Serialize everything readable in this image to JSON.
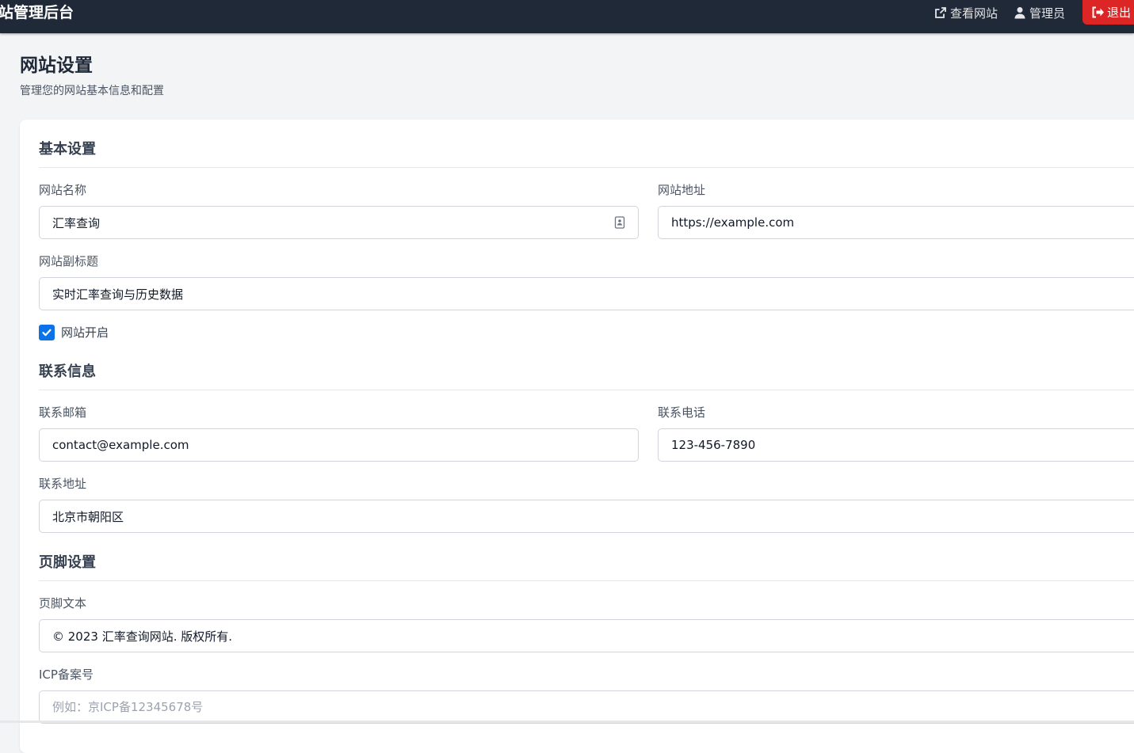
{
  "header": {
    "brand": "站管理后台",
    "view_site_label": "查看网站",
    "user_label": "管理员",
    "logout_label": "退出"
  },
  "page": {
    "title": "网站设置",
    "subtitle": "管理您的网站基本信息和配置"
  },
  "sections": {
    "basic": {
      "title": "基本设置",
      "site_name_label": "网站名称",
      "site_name_value": "汇率查询",
      "site_url_label": "网站地址",
      "site_url_value": "https://example.com",
      "subtitle_label": "网站副标题",
      "subtitle_value": "实时汇率查询与历史数据",
      "site_open_label": "网站开启",
      "site_open_checked": true
    },
    "contact": {
      "title": "联系信息",
      "email_label": "联系邮箱",
      "email_value": "contact@example.com",
      "phone_label": "联系电话",
      "phone_value": "123-456-7890",
      "address_label": "联系地址",
      "address_value": "北京市朝阳区"
    },
    "footer": {
      "title": "页脚设置",
      "footer_text_label": "页脚文本",
      "footer_text_value": "© 2023 汇率查询网站. 版权所有.",
      "icp_label": "ICP备案号",
      "icp_placeholder": "例如：京ICP备12345678号"
    }
  },
  "colors": {
    "topbar": "#1f2937",
    "logout": "#dc2626",
    "checkbox": "#0b72e7",
    "page_bg": "#f3f4f6"
  }
}
